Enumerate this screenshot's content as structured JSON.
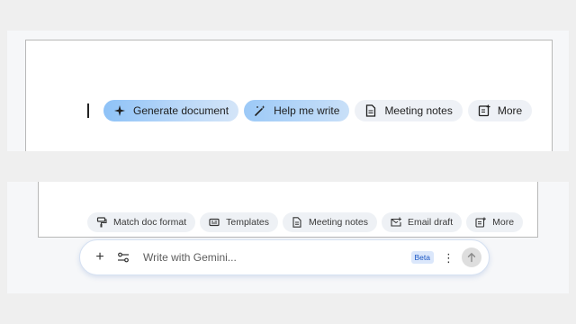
{
  "top": {
    "chips": [
      {
        "label": "Generate document",
        "icon": "sparkle-icon"
      },
      {
        "label": "Help me write",
        "icon": "magic-pen-icon"
      },
      {
        "label": "Meeting notes",
        "icon": "document-icon"
      },
      {
        "label": "More",
        "icon": "note-add-icon"
      }
    ]
  },
  "bottom": {
    "chips": [
      {
        "label": "Match doc format",
        "icon": "format-paint-icon"
      },
      {
        "label": "Templates",
        "icon": "template-icon"
      },
      {
        "label": "Meeting notes",
        "icon": "document-icon"
      },
      {
        "label": "Email draft",
        "icon": "email-icon"
      },
      {
        "label": "More",
        "icon": "note-add-icon"
      }
    ]
  },
  "gemini": {
    "placeholder": "Write with Gemini...",
    "badge": "Beta",
    "plus_glyph": "+",
    "kebab_glyph": "⋮"
  },
  "colors": {
    "accent_gradient_start": "#8ec2f7",
    "chip_bg": "#eef1f6",
    "send_bg": "#dedede",
    "beta_text": "#1a56c4"
  }
}
